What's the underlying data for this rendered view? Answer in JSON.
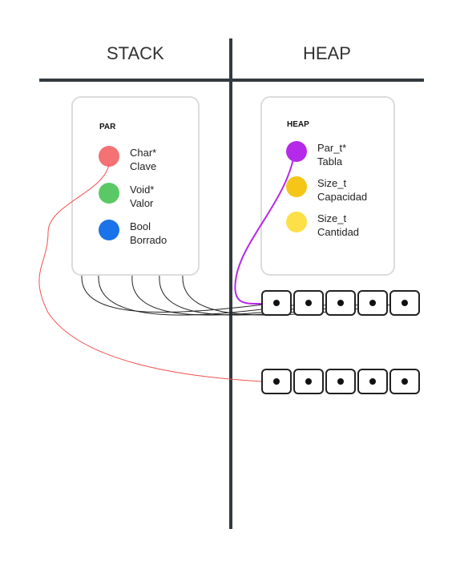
{
  "columns": {
    "left": "STACK",
    "right": "HEAP"
  },
  "par_card": {
    "title": "PAR",
    "fields": [
      {
        "type": "Char*",
        "name": "Clave",
        "color": "#f47174"
      },
      {
        "type": "Void*",
        "name": "Valor",
        "color": "#5bc866"
      },
      {
        "type": "Bool",
        "name": "Borrado",
        "color": "#1a73e8"
      }
    ]
  },
  "heap_card": {
    "title": "HEAP",
    "fields": [
      {
        "type": "Par_t*",
        "name": "Tabla",
        "color": "#b52ae8"
      },
      {
        "type": "Size_t",
        "name": "Capacidad",
        "color": "#f5c518"
      },
      {
        "type": "Size_t",
        "name": "Cantidad",
        "color": "#fde047"
      }
    ]
  },
  "arrays": {
    "table_cells": 5,
    "key_cells": 5
  },
  "colors": {
    "divider": "#333a40",
    "clave_link": "#f0524f",
    "tabla_link": "#b52ae8",
    "cell_links": "#222222"
  }
}
